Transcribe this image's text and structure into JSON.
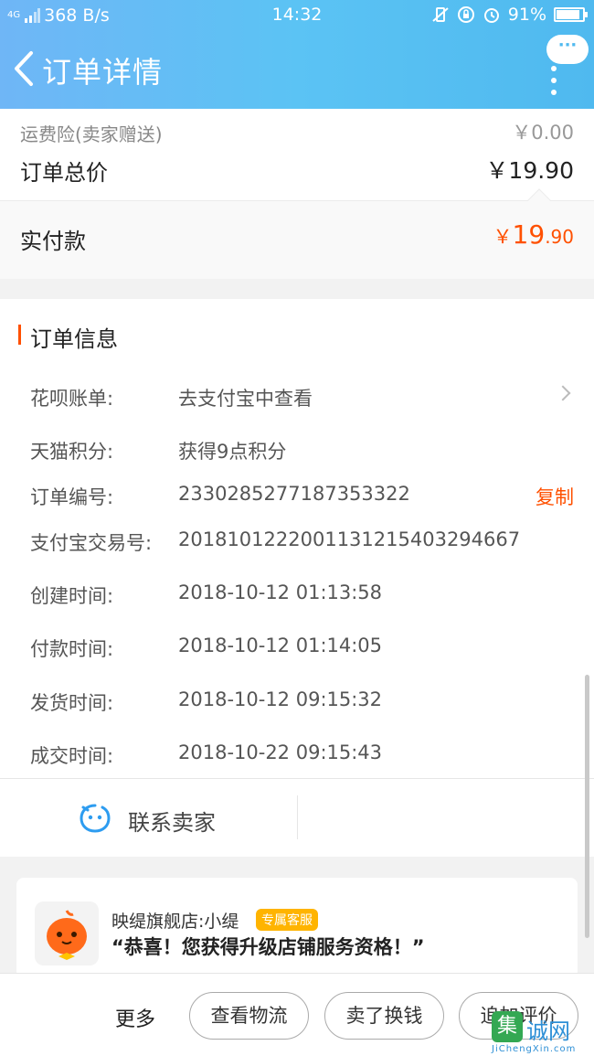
{
  "status_bar": {
    "network": "4G",
    "speed": "368 B/s",
    "time": "14:32",
    "battery": "91%",
    "battery_level": 0.91
  },
  "nav": {
    "title": "订单详情",
    "more_dots": "···"
  },
  "price": {
    "insurance_label": "运费险(卖家赠送)",
    "insurance_value": "￥0.00",
    "total_label": "订单总价",
    "total_value": "￥19.90",
    "paid_label": "实付款",
    "paid_symbol": "￥",
    "paid_integer": "19",
    "paid_decimal": ".90"
  },
  "order_info": {
    "title": "订单信息",
    "rows": [
      {
        "label": "花呗账单:",
        "value": "去支付宝中查看"
      },
      {
        "label": "天猫积分:",
        "value": "获得9点积分"
      },
      {
        "label": "订单编号:",
        "value": "2330285277187353322",
        "action": "复制"
      },
      {
        "label": "支付宝交易号:",
        "value": "2018101222001131215403294667"
      },
      {
        "label": "创建时间:",
        "value": "2018-10-12 01:13:58"
      },
      {
        "label": "付款时间:",
        "value": "2018-10-12 01:14:05"
      },
      {
        "label": "发货时间:",
        "value": "2018-10-12 09:15:32"
      },
      {
        "label": "成交时间:",
        "value": "2018-10-22 09:15:43"
      }
    ],
    "contact_label": "联系卖家"
  },
  "message": {
    "shop": "映缇旗舰店:小缇",
    "badge": "专属客服",
    "text": "“恭喜！您获得升级店铺服务资格！”"
  },
  "bottom": {
    "more": "更多",
    "buttons": [
      "查看物流",
      "卖了换钱",
      "追加评价"
    ]
  },
  "watermark": {
    "brand_char": "集",
    "text": "诚网",
    "sub": "JiChengXin.com"
  }
}
